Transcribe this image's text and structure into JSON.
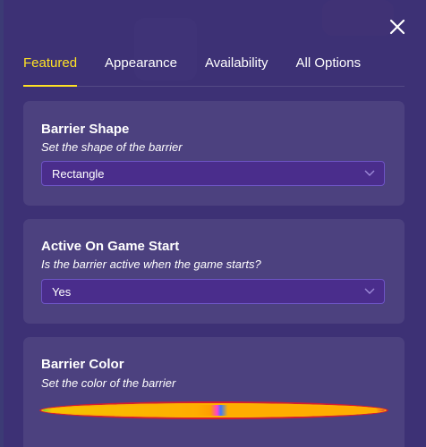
{
  "tabs": [
    {
      "label": "Featured",
      "active": true
    },
    {
      "label": "Appearance",
      "active": false
    },
    {
      "label": "Availability",
      "active": false
    },
    {
      "label": "All Options",
      "active": false
    }
  ],
  "cards": {
    "shape": {
      "title": "Barrier Shape",
      "subtitle": "Set the shape of the barrier",
      "value": "Rectangle"
    },
    "active": {
      "title": "Active On Game Start",
      "subtitle": "Is the barrier active when the game starts?",
      "value": "Yes"
    },
    "color": {
      "title": "Barrier Color",
      "subtitle": "Set the color of the barrier",
      "value_color": "#ffad00"
    }
  },
  "icons": {
    "close": "close-icon",
    "chevron": "chevron-down-icon"
  },
  "colors": {
    "accent": "#ffe224",
    "panel": "#3e3276",
    "select_bg": "#4a2d8c"
  }
}
